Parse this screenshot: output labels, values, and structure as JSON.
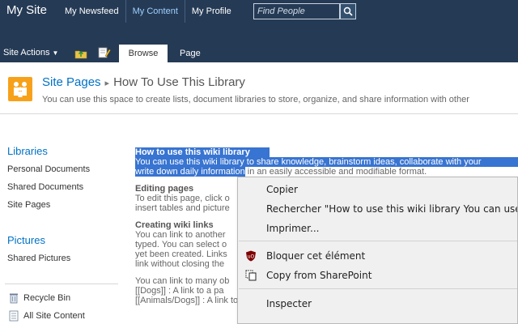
{
  "topbar": {
    "site_title": "My Site",
    "nav": [
      {
        "label": "My Newsfeed"
      },
      {
        "label": "My Content"
      },
      {
        "label": "My Profile"
      }
    ],
    "search_placeholder": "Find People"
  },
  "ribbon": {
    "site_actions": "Site Actions",
    "tabs": [
      {
        "label": "Browse"
      },
      {
        "label": "Page"
      }
    ]
  },
  "title_area": {
    "breadcrumb_root": "Site Pages",
    "breadcrumb_current": "How To Use This Library",
    "description": "You can use this space to create lists, document libraries to store, organize, and share information with other"
  },
  "leftnav": {
    "sections": [
      {
        "heading": "Libraries",
        "links": [
          "Personal Documents",
          "Shared Documents",
          "Site Pages"
        ]
      },
      {
        "heading": "Pictures",
        "links": [
          "Shared Pictures"
        ]
      }
    ],
    "bottom": [
      {
        "label": "Recycle Bin",
        "icon": "recycle-bin-icon"
      },
      {
        "label": "All Site Content",
        "icon": "all-content-icon"
      }
    ]
  },
  "content": {
    "selected_heading": "How to use this wiki library",
    "selected_line1": "You can use this wiki library to share knowledge, brainstorm ideas, collaborate with your",
    "selected_line2": "write down daily information",
    "line2_rest": " in an easily accessible and modifiable format.",
    "editing_heading": "Editing pages",
    "editing_lines": [
      "To edit this page, click o",
      "insert tables and picture"
    ],
    "creating_heading": "Creating wiki links",
    "creating_lines": [
      "You can link to another",
      "typed. You can select o",
      "yet been created. Links",
      "link without closing the"
    ],
    "more_lines": [
      "You can link to many ob",
      "[[Dogs]] : A link to a pa",
      "[[Animals/Dogs]] : A link to a page named Dogs in a subfolder called Animals."
    ]
  },
  "context_menu": {
    "items": [
      {
        "label": "Copier"
      },
      {
        "label": "Rechercher \"How to use this wiki library You can use this wiki library to share"
      },
      {
        "label": "Imprimer..."
      },
      {
        "label": "Bloquer cet élément",
        "icon": "ublock-icon"
      },
      {
        "label": "Copy from SharePoint",
        "icon": "copy-icon"
      },
      {
        "label": "Inspecter"
      }
    ]
  },
  "colors": {
    "topbar_bg": "#253a55",
    "link_blue": "#0072c6",
    "selection": "#3874d1",
    "logo_orange": "#f7a11a"
  }
}
